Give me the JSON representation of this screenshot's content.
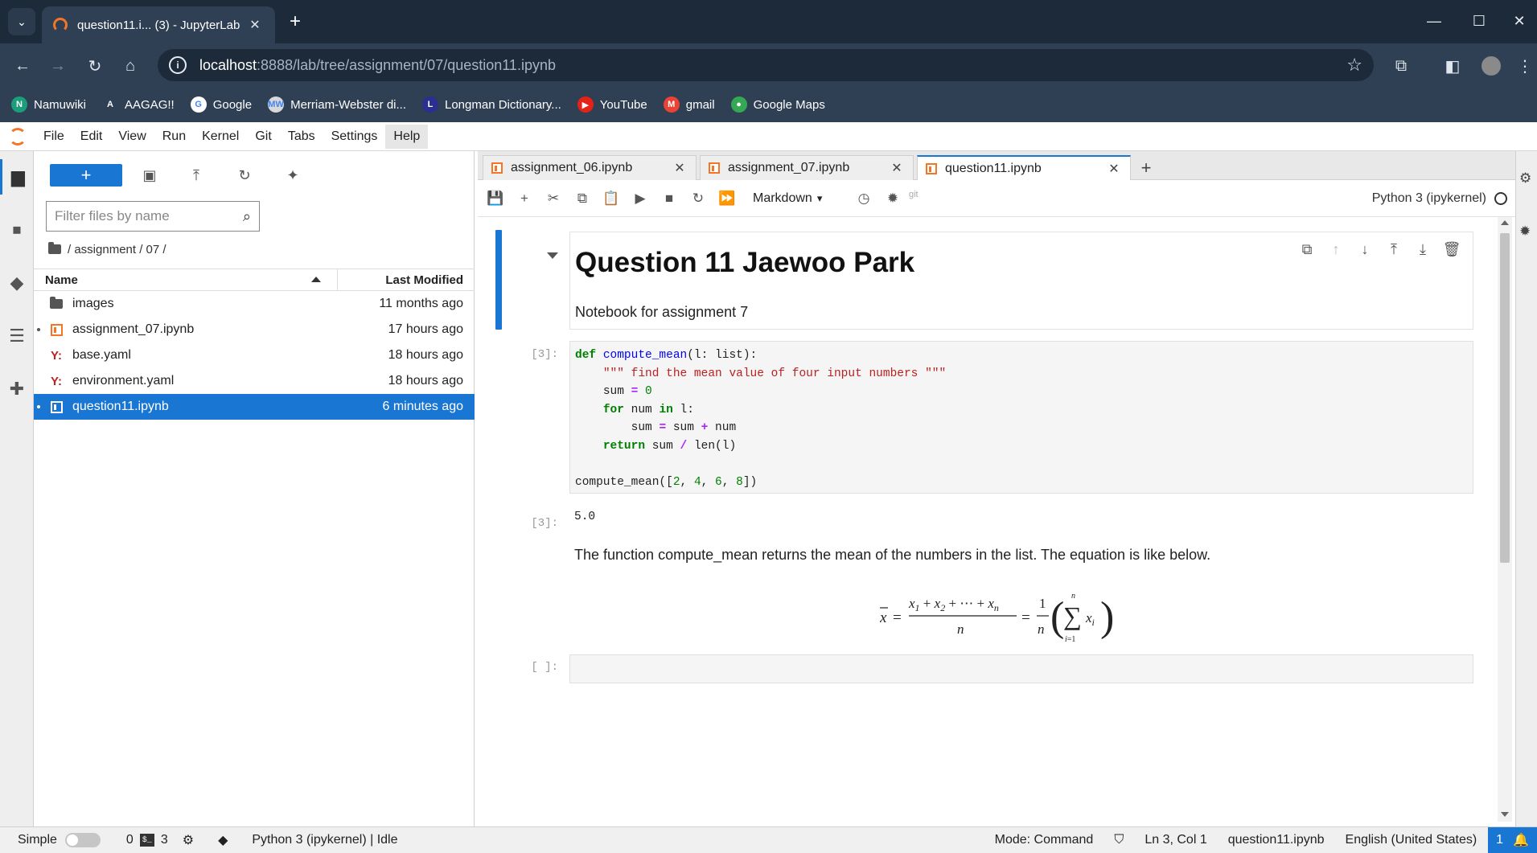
{
  "browser": {
    "tab_title": "question11.i... (3) - JupyterLab",
    "url_host": "localhost",
    "url_path": ":8888/lab/tree/assignment/07/question11.ipynb",
    "bookmarks": [
      {
        "label": "Namuwiki",
        "color": "#1a9f7a",
        "glyph": "N"
      },
      {
        "label": "AAGAG!!",
        "color": "#2f3f54",
        "glyph": "A"
      },
      {
        "label": "Google",
        "color": "#ffffff",
        "glyph": "G"
      },
      {
        "label": "Merriam-Webster di...",
        "color": "#d8d8d8",
        "glyph": "MW"
      },
      {
        "label": "Longman Dictionary...",
        "color": "#2b2f8f",
        "glyph": "L"
      },
      {
        "label": "YouTube",
        "color": "#e62117",
        "glyph": "▶"
      },
      {
        "label": "gmail",
        "color": "#ea4335",
        "glyph": "M"
      },
      {
        "label": "Google Maps",
        "color": "#34a853",
        "glyph": "●"
      }
    ]
  },
  "menubar": {
    "items": [
      "File",
      "Edit",
      "View",
      "Run",
      "Kernel",
      "Git",
      "Tabs",
      "Settings",
      "Help"
    ]
  },
  "filebrowser": {
    "filter_placeholder": "Filter files by name",
    "breadcrumb": "/ assignment / 07 /",
    "col_name": "Name",
    "col_modified": "Last Modified",
    "files": [
      {
        "name": "images",
        "modified": "11 months ago",
        "type": "folder"
      },
      {
        "name": "assignment_07.ipynb",
        "modified": "17 hours ago",
        "type": "notebook"
      },
      {
        "name": "base.yaml",
        "modified": "18 hours ago",
        "type": "yaml"
      },
      {
        "name": "environment.yaml",
        "modified": "18 hours ago",
        "type": "yaml"
      },
      {
        "name": "question11.ipynb",
        "modified": "6 minutes ago",
        "type": "notebook"
      }
    ]
  },
  "notebook": {
    "tabs": [
      "assignment_06.ipynb",
      "assignment_07.ipynb",
      "question11.ipynb"
    ],
    "cell_type": "Markdown",
    "git_label": "git",
    "kernel": "Python 3 (ipykernel)",
    "md_title": "Question 11 Jaewoo Park",
    "md_subtitle": "Notebook for assignment 7",
    "code_prompt": "[3]:",
    "output_prompt": "[3]:",
    "output_value": "5.0",
    "md_text": "The function compute_mean returns the mean of the numbers in the list. The equation is like below.",
    "empty_prompt": "[ ]:",
    "code": {
      "l1_kw": "def",
      "l1_fn": "compute_mean",
      "l1_rest": "(l: list):",
      "l2_str": "\"\"\" find the mean value of four input numbers \"\"\"",
      "l3_a": "sum ",
      "l3_op": "=",
      "l3_num": "0",
      "l4_kw1": "for",
      "l4_mid": " num ",
      "l4_kw2": "in",
      "l4_rest": " l:",
      "l5_a": "sum ",
      "l5_op1": "=",
      "l5_b": " sum ",
      "l5_op2": "+",
      "l5_c": " num",
      "l6_kw": "return",
      "l6_a": " sum ",
      "l6_op": "/",
      "l6_b": " len(l)",
      "l8_a": "compute_mean([",
      "l8_n1": "2",
      "l8_n2": "4",
      "l8_n3": "6",
      "l8_n4": "8",
      "l8_b": "])"
    }
  },
  "statusbar": {
    "simple": "Simple",
    "count1": "0",
    "count2": "3",
    "kernel_status": "Python 3 (ipykernel) | Idle",
    "mode": "Mode: Command",
    "position": "Ln 3, Col 1",
    "filename": "question11.ipynb",
    "language": "English (United States)",
    "notifications": "1"
  }
}
